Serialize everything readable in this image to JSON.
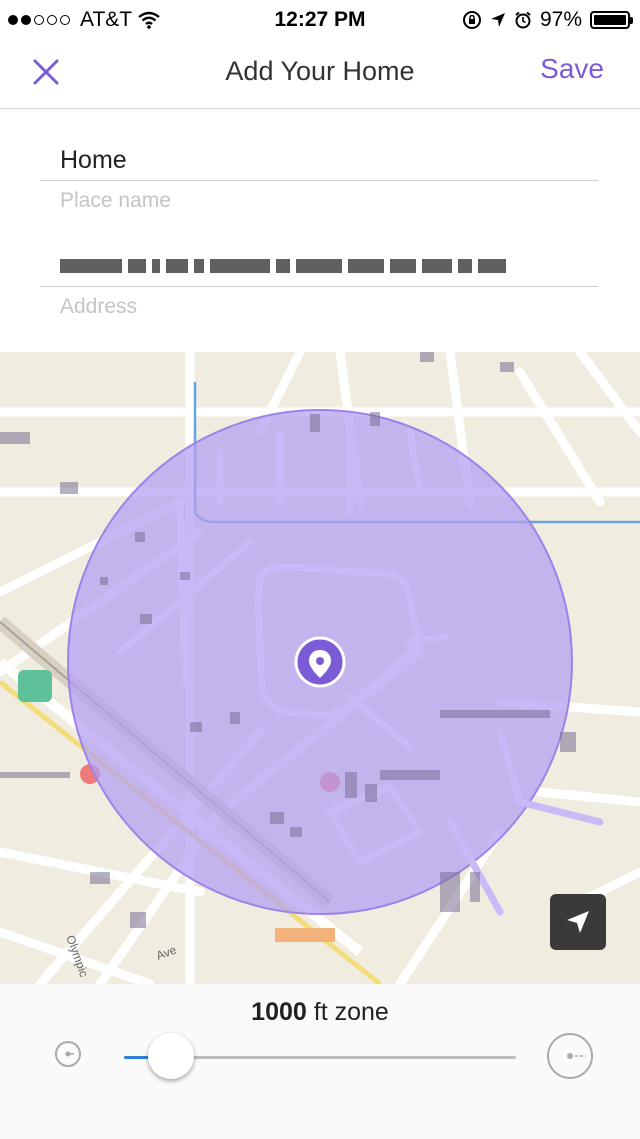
{
  "status": {
    "carrier": "AT&T",
    "time": "12:27 PM",
    "battery": "97%",
    "signal_filled": 2,
    "signal_total": 5,
    "battery_level": 0.97
  },
  "nav": {
    "title": "Add Your Home",
    "save_label": "Save"
  },
  "form": {
    "place_value": "Home",
    "place_label": "Place name",
    "address_label": "Address"
  },
  "map": {
    "street_label_1": "Olympic",
    "street_label_2": "Ave"
  },
  "zone": {
    "value": "1000",
    "unit": "ft zone",
    "slider_level": 0.12
  },
  "colors": {
    "accent": "#7b5bd6",
    "zone_fill": "#b39ef2",
    "slider_fill": "#2d7fd6"
  }
}
